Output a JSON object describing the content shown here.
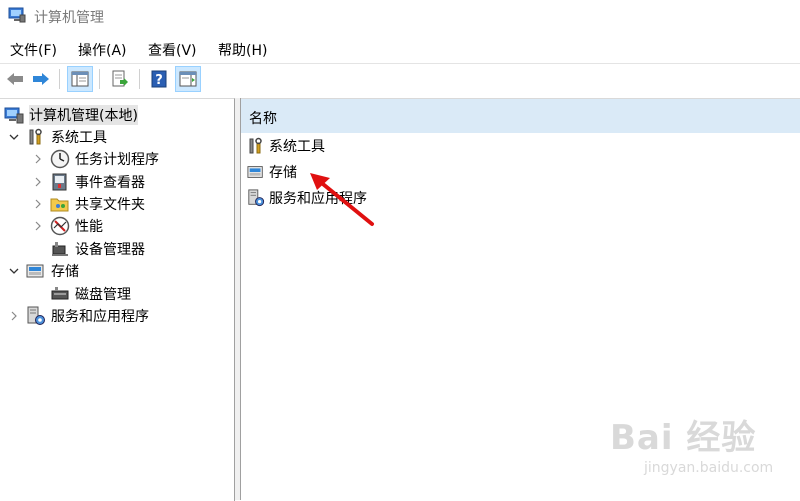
{
  "window": {
    "title": "计算机管理"
  },
  "menu": {
    "items": [
      {
        "label": "文件(F)"
      },
      {
        "label": "操作(A)"
      },
      {
        "label": "查看(V)"
      },
      {
        "label": "帮助(H)"
      }
    ]
  },
  "toolbar": {
    "buttons": [
      {
        "icon": "back-arrow-icon"
      },
      {
        "icon": "forward-arrow-icon"
      },
      {
        "icon": "console-tree-icon"
      },
      {
        "icon": "export-list-icon"
      },
      {
        "icon": "help-icon"
      },
      {
        "icon": "action-pane-icon"
      }
    ]
  },
  "tree": {
    "root": {
      "label": "计算机管理(本地)",
      "icon": "computer-management-icon"
    },
    "system_tools": {
      "label": "系统工具",
      "icon": "tools-icon",
      "children": [
        {
          "label": "任务计划程序",
          "icon": "clock-icon"
        },
        {
          "label": "事件查看器",
          "icon": "event-viewer-icon"
        },
        {
          "label": "共享文件夹",
          "icon": "shared-folder-icon"
        },
        {
          "label": "性能",
          "icon": "performance-icon"
        },
        {
          "label": "设备管理器",
          "icon": "device-manager-icon"
        }
      ]
    },
    "storage": {
      "label": "存储",
      "icon": "storage-icon",
      "children": [
        {
          "label": "磁盘管理",
          "icon": "disk-management-icon"
        }
      ]
    },
    "services": {
      "label": "服务和应用程序",
      "icon": "services-icon"
    }
  },
  "list": {
    "header": "名称",
    "items": [
      {
        "label": "系统工具",
        "icon": "tools-icon"
      },
      {
        "label": "存储",
        "icon": "storage-icon"
      },
      {
        "label": "服务和应用程序",
        "icon": "services-icon"
      }
    ]
  },
  "watermark": {
    "logo": "Bai 经验",
    "url": "jingyan.baidu.com"
  },
  "colors": {
    "header_bg": "#daeaf7",
    "annotation": "#e01010",
    "selected_bg": "#e5e5e5"
  }
}
